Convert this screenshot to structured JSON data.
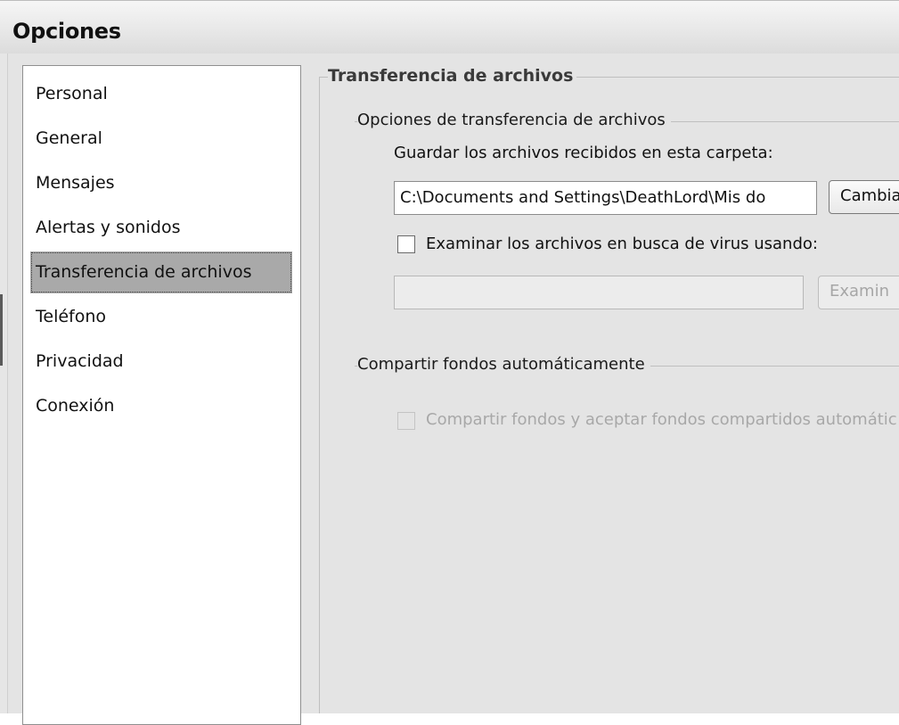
{
  "window": {
    "title": "Opciones"
  },
  "sidebar": {
    "items": [
      {
        "label": "Personal",
        "selected": false
      },
      {
        "label": "General",
        "selected": false
      },
      {
        "label": "Mensajes",
        "selected": false
      },
      {
        "label": "Alertas y sonidos",
        "selected": false
      },
      {
        "label": "Transferencia de archivos",
        "selected": true
      },
      {
        "label": "Teléfono",
        "selected": false
      },
      {
        "label": "Privacidad",
        "selected": false
      },
      {
        "label": "Conexión",
        "selected": false
      }
    ]
  },
  "main": {
    "section_title": "Transferencia de archivos",
    "file_transfer_group": {
      "title": "Opciones de transferencia de archivos",
      "save_folder_label": "Guardar los archivos recibidos en esta carpeta:",
      "save_folder_value": "C:\\Documents and Settings\\DeathLord\\Mis do",
      "change_button": "Cambia",
      "scan_checkbox_label": "Examinar los archivos en busca de virus usando:",
      "scan_checkbox_checked": false,
      "scanner_path_value": "",
      "browse_button": "Examin"
    },
    "backgrounds_group": {
      "title": "Compartir fondos automáticamente",
      "share_checkbox_label": "Compartir fondos y aceptar fondos compartidos automátic",
      "share_checkbox_checked": false
    }
  },
  "colors": {
    "window_bg": "#e4e4e4",
    "selected_item_bg": "#a9a9a9",
    "disabled_text": "#a8a8a8"
  }
}
